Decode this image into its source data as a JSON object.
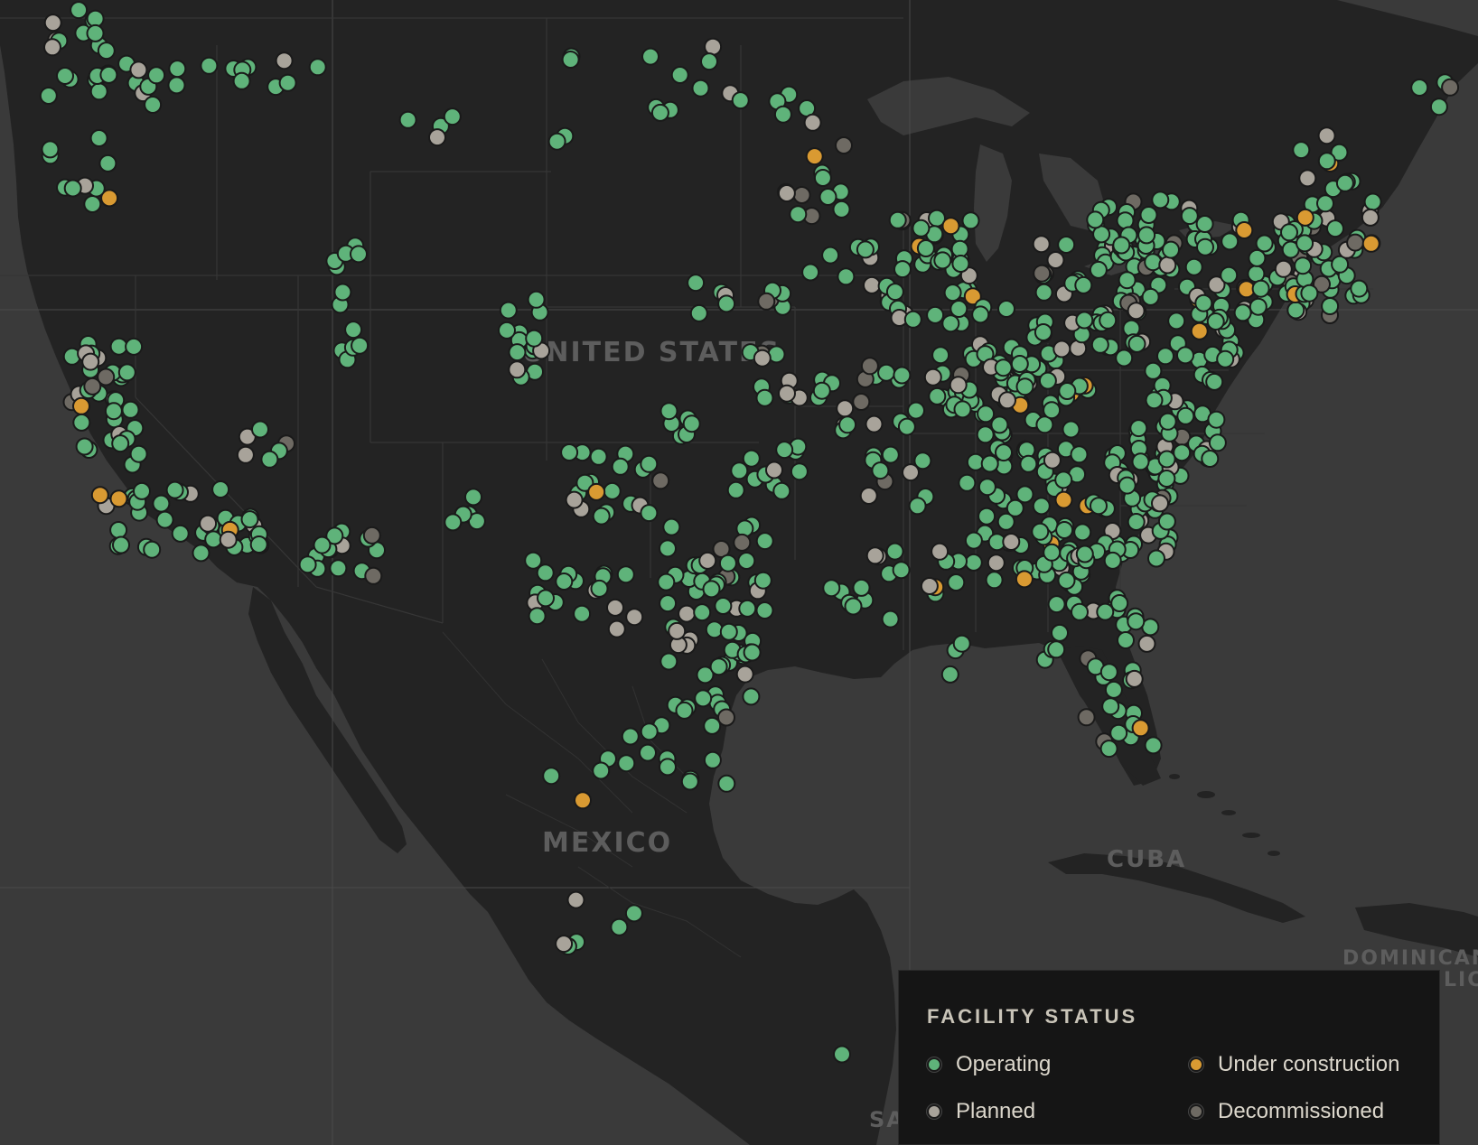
{
  "map": {
    "labels": {
      "united_states": "UNITED STATES",
      "mexico": "MEXICO",
      "cuba": "CUBA",
      "dominican": "DOMINICAN",
      "dominican_cont": "LIC",
      "sa": "SA"
    }
  },
  "legend": {
    "title": "FACILITY STATUS",
    "items": [
      {
        "key": "operating",
        "label": "Operating",
        "color": "#5fb37a"
      },
      {
        "key": "under_construction",
        "label": "Under construction",
        "color": "#d99a32"
      },
      {
        "key": "planned",
        "label": "Planned",
        "color": "#a8a39a"
      },
      {
        "key": "decommissioned",
        "label": "Decommissioned",
        "color": "#6e6a63"
      }
    ]
  },
  "colors": {
    "land": "#232323",
    "water": "#3a3a3a",
    "operating": "#5fb37a",
    "under_construction": "#d99a32",
    "planned": "#a8a39a",
    "decommissioned": "#6e6a63"
  },
  "facilities_summary": {
    "shown": "approx. 900 facility markers across the United States and Mexico"
  }
}
